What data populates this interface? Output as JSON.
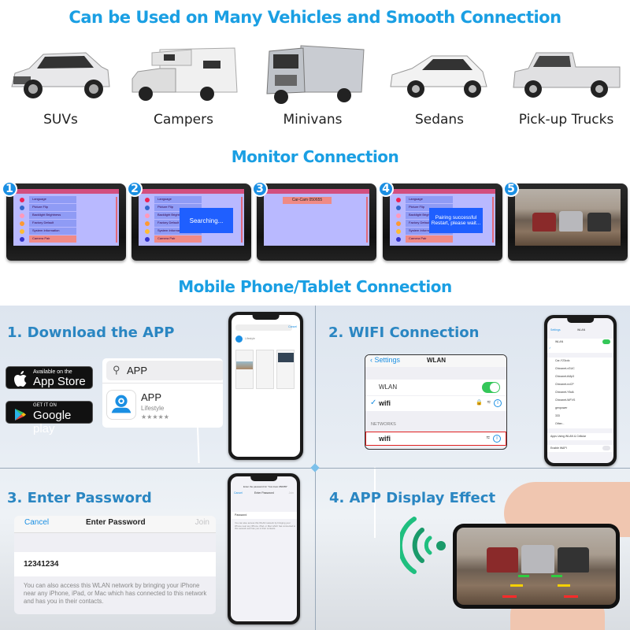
{
  "headings": {
    "vehicles": "Can be Used on Many Vehicles and Smooth Connection",
    "monitor": "Monitor Connection",
    "mobile": "Mobile Phone/Tablet Connection"
  },
  "vehicles": [
    {
      "label": "SUVs",
      "icon": "suv-image"
    },
    {
      "label": "Campers",
      "icon": "camper-image"
    },
    {
      "label": "Minivans",
      "icon": "box-truck-image"
    },
    {
      "label": "Sedans",
      "icon": "sedan-image"
    },
    {
      "label": "Pick-up Trucks",
      "icon": "pickup-truck-image"
    }
  ],
  "monitor_steps": [
    {
      "number": "1",
      "menu": [
        "Language",
        "Picture Flip",
        "Backlight Brightness",
        "Factory Default",
        "System Information",
        "Camera Pair"
      ],
      "active": "Camera Pair"
    },
    {
      "number": "2",
      "menu": [
        "Language",
        "Picture Flip",
        "Backlight Brightness",
        "Factory Default",
        "System Information",
        "Camera Pair"
      ],
      "popup": "Searching..."
    },
    {
      "number": "3",
      "device": "Car-Cam 050655"
    },
    {
      "number": "4",
      "menu": [
        "Language",
        "Picture Flip",
        "Backlight Brightness",
        "Factory Default",
        "System Information",
        "Camera Pair"
      ],
      "popup_line1": "Pairing successful",
      "popup_line2": "Restart, please wait..."
    },
    {
      "number": "5",
      "scene": "camera-feed-three-cars"
    }
  ],
  "panels": {
    "download": {
      "title": "1. Download the APP",
      "appstore_small": "Available on the",
      "appstore_big": "App Store",
      "google_small": "GET IT ON",
      "google_big": "Google play",
      "search_query": "APP",
      "app_name": "APP",
      "app_category": "Lifestyle",
      "app_rating": "★★★★★",
      "phone_cancel": "Cancel",
      "phone_category": "Lifestyle"
    },
    "wifi": {
      "title": "2. WIFI Connection",
      "back_label": "Settings",
      "nav_title": "WLAN",
      "wlan_label": "WLAN",
      "wlan_on": true,
      "connected_network": "wifi",
      "networks_header": "NETWORKS",
      "highlighted_network": "wifi",
      "highlight_color": "#e02020",
      "phone_networks": [
        "Car-Y23cdc",
        "Chinanet-vGUC",
        "Chinanet-bMp3",
        "Chinanet-nxCP",
        "Chinanet-Y5dA",
        "Chinanet-WFVS",
        "genpower",
        "333",
        "Other..."
      ],
      "phone_apps_label": "Apps Using WLAN & Cellular",
      "phone_enable_label": "Enable WAPI"
    },
    "password": {
      "title": "3. Enter Password",
      "cancel": "Cancel",
      "nav_title": "Enter Password",
      "join": "Join",
      "password_value": "12341234",
      "hint": "You can also access this WLAN network by bringing your iPhone near any iPhone, iPad, or Mac which has connected to this network and has you in their contacts.",
      "phone_prompt": "Enter the password for \"Car-Cam 050655\"",
      "phone_field_label": "Password"
    },
    "display": {
      "title": "4. APP Display Effect",
      "signal_icon": "wireless-signal-icon"
    }
  },
  "colors": {
    "accent": "#1a9fe3",
    "panel_title": "#2a86c2",
    "signal": "#1fbf7f",
    "toggle_on": "#34c759"
  }
}
